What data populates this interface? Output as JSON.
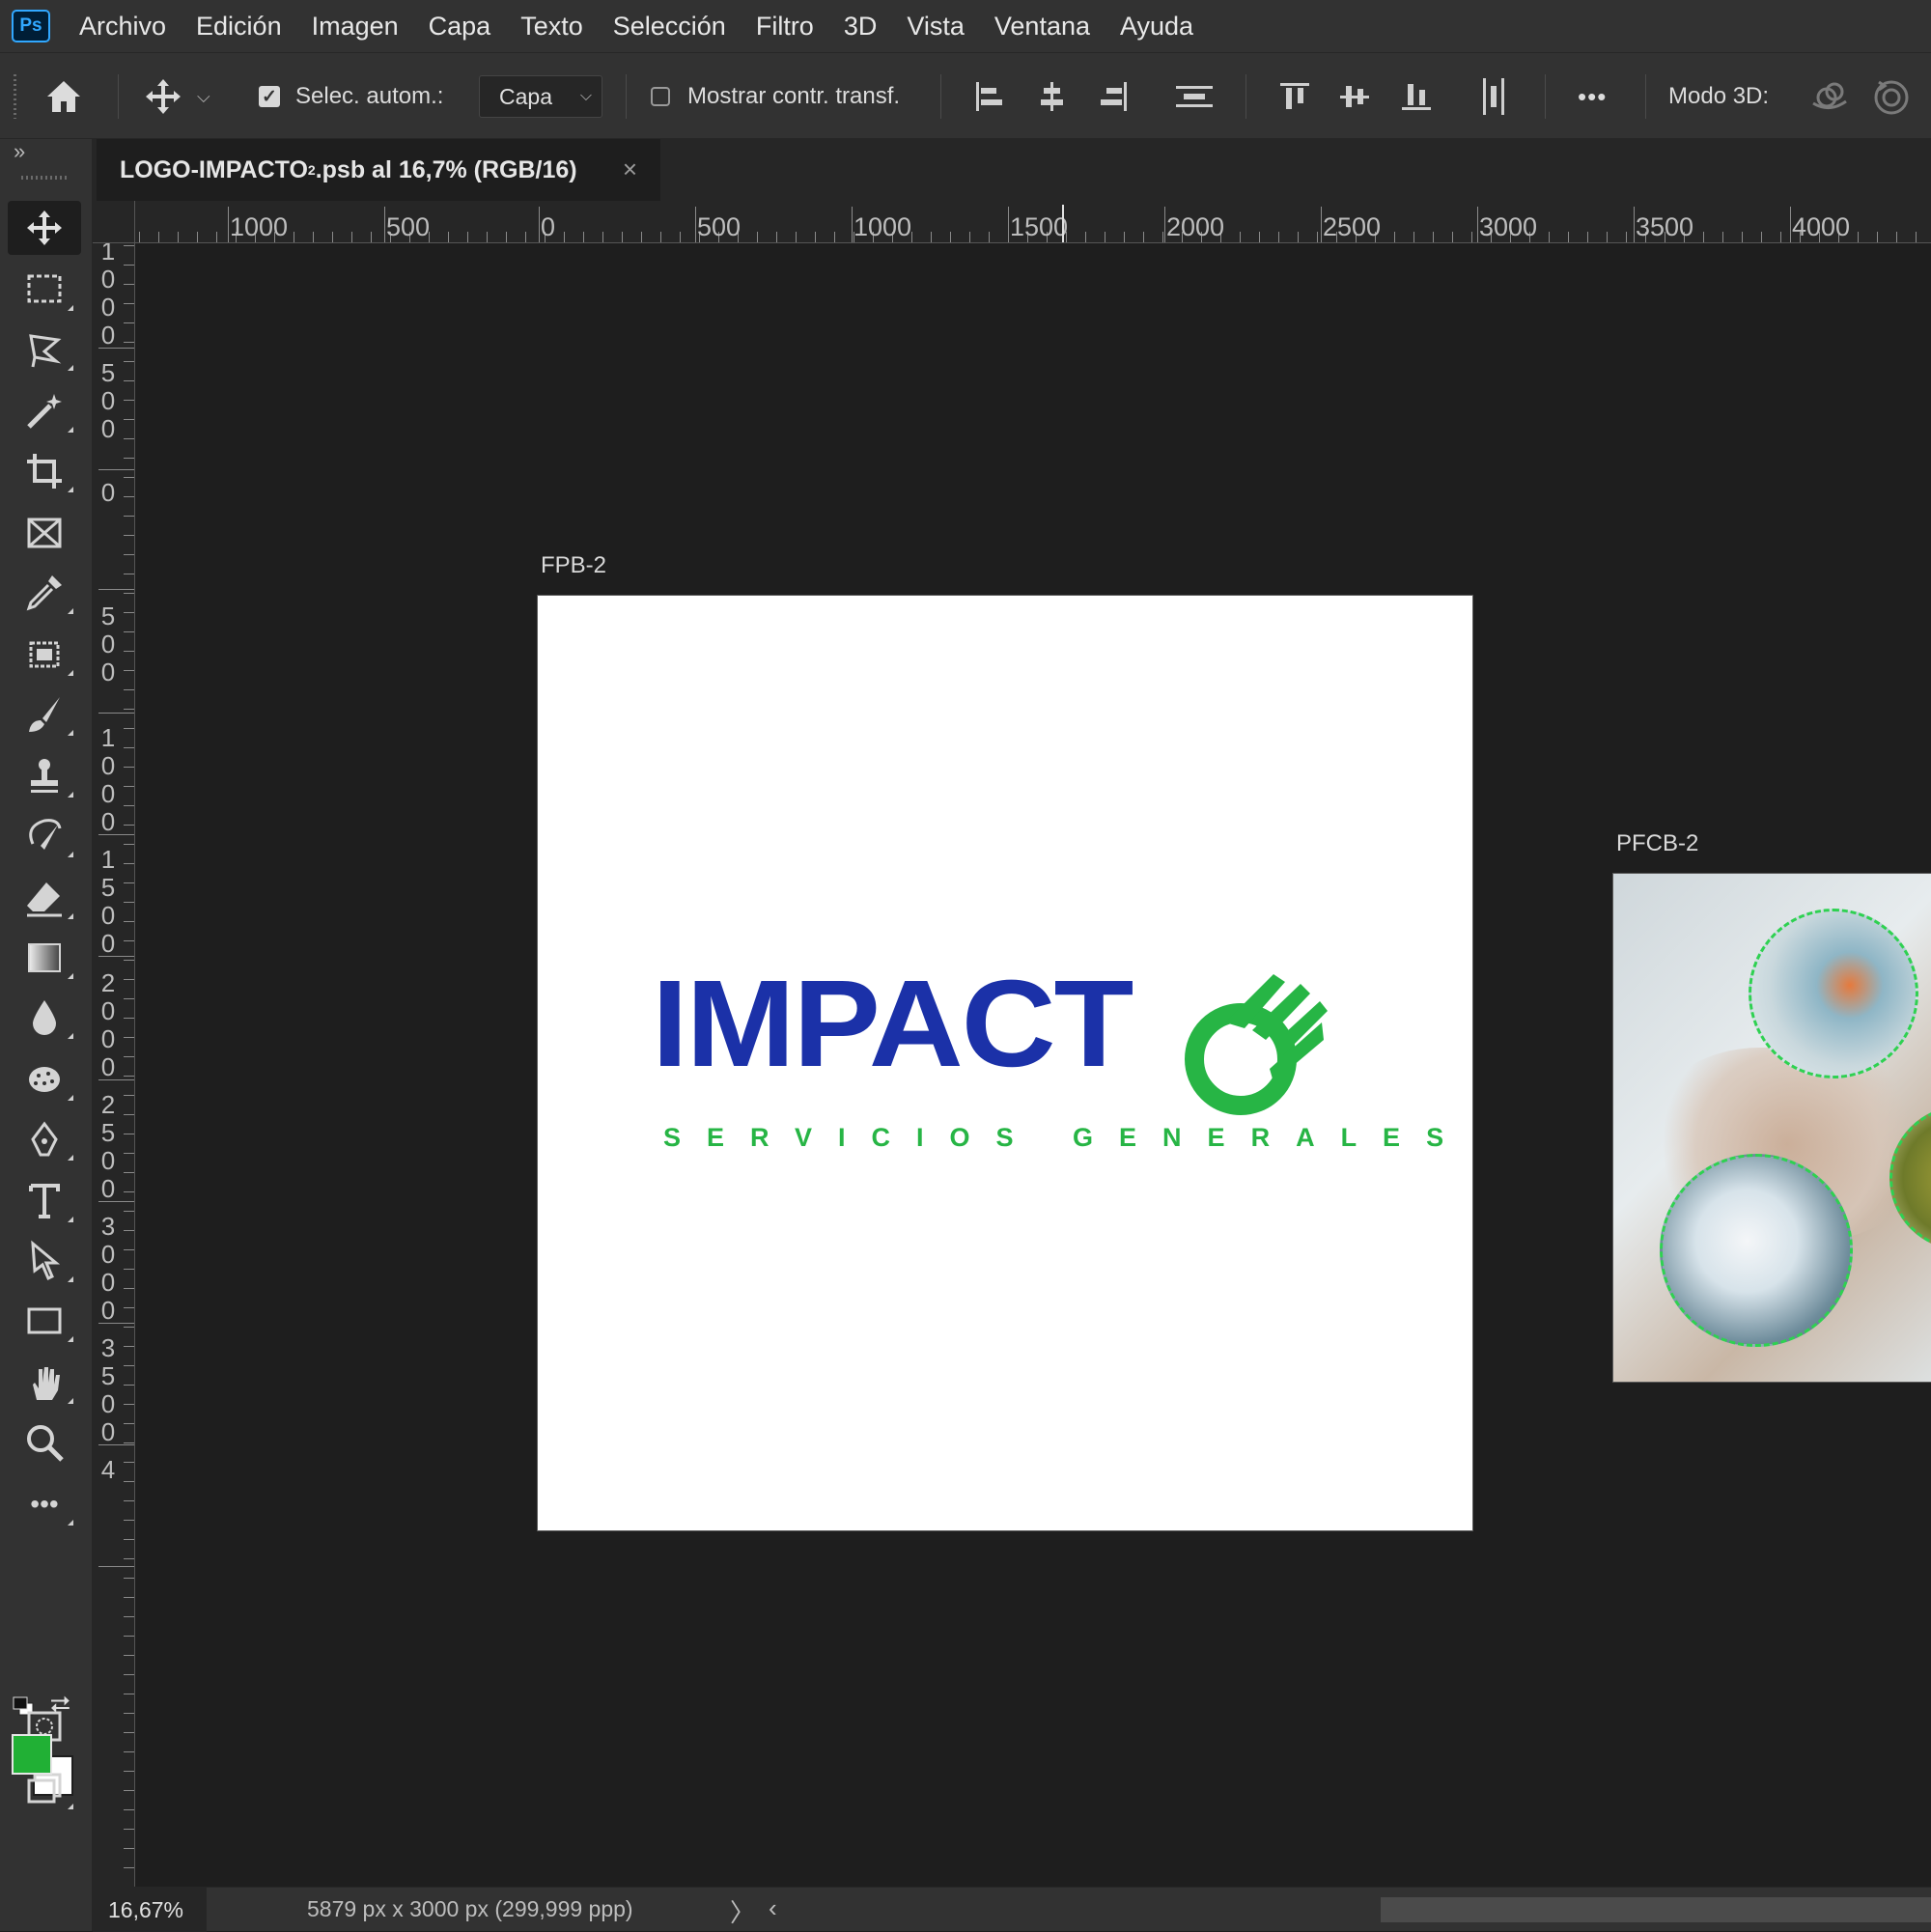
{
  "app": {
    "logo_text": "Ps"
  },
  "menu": [
    "Archivo",
    "Edición",
    "Imagen",
    "Capa",
    "Texto",
    "Selección",
    "Filtro",
    "3D",
    "Vista",
    "Ventana",
    "Ayuda"
  ],
  "options": {
    "auto_select_label": "Selec. autom.:",
    "auto_select_checked": true,
    "layer_dropdown": "Capa",
    "show_transform_label": "Mostrar contr. transf.",
    "show_transform_checked": false,
    "more_label": "•••",
    "mode_3d_label": "Modo 3D:"
  },
  "document_tab": {
    "name": "LOGO-IMPACTO",
    "superscript": "2",
    "suffix": ".psb al 16,7% (RGB/16)",
    "close": "×"
  },
  "rulers": {
    "horizontal": [
      "1000",
      "500",
      "0",
      "500",
      "1000",
      "1500",
      "2000",
      "2500",
      "3000",
      "3500",
      "4000"
    ],
    "vertical": [
      "1000",
      "500",
      "0",
      "500",
      "1000",
      "1500",
      "2000",
      "2500",
      "3000",
      "3500",
      "4"
    ]
  },
  "canvas": {
    "artboard_1": {
      "label": "FPB-2",
      "logo_wordmark": "IMPACT",
      "logo_tagline": "SERVICIOS GENERALES",
      "wordmark_color": "#1b31a8",
      "accent_color": "#27b545"
    },
    "artboard_2": {
      "label": "PFCB-2"
    }
  },
  "colors": {
    "foreground": "#21b035",
    "background": "#ffffff"
  },
  "status": {
    "zoom": "16,67%",
    "doc_info": "5879 px x 3000 px (299,999 ppp)",
    "arrow": "〉",
    "scroll_left": "‹"
  },
  "tools": [
    "move-tool",
    "marquee-tool",
    "lasso-tool",
    "magic-wand-tool",
    "crop-tool",
    "frame-tool",
    "eyedropper-tool",
    "content-aware-tool",
    "brush-tool",
    "stamp-tool",
    "history-brush-tool",
    "eraser-tool",
    "gradient-tool",
    "blur-tool",
    "dodge-tool",
    "pen-tool",
    "type-tool",
    "path-selection-tool",
    "rectangle-tool",
    "hand-tool",
    "zoom-tool",
    "more-tools",
    "quick-mask-mode",
    "screen-mode"
  ]
}
